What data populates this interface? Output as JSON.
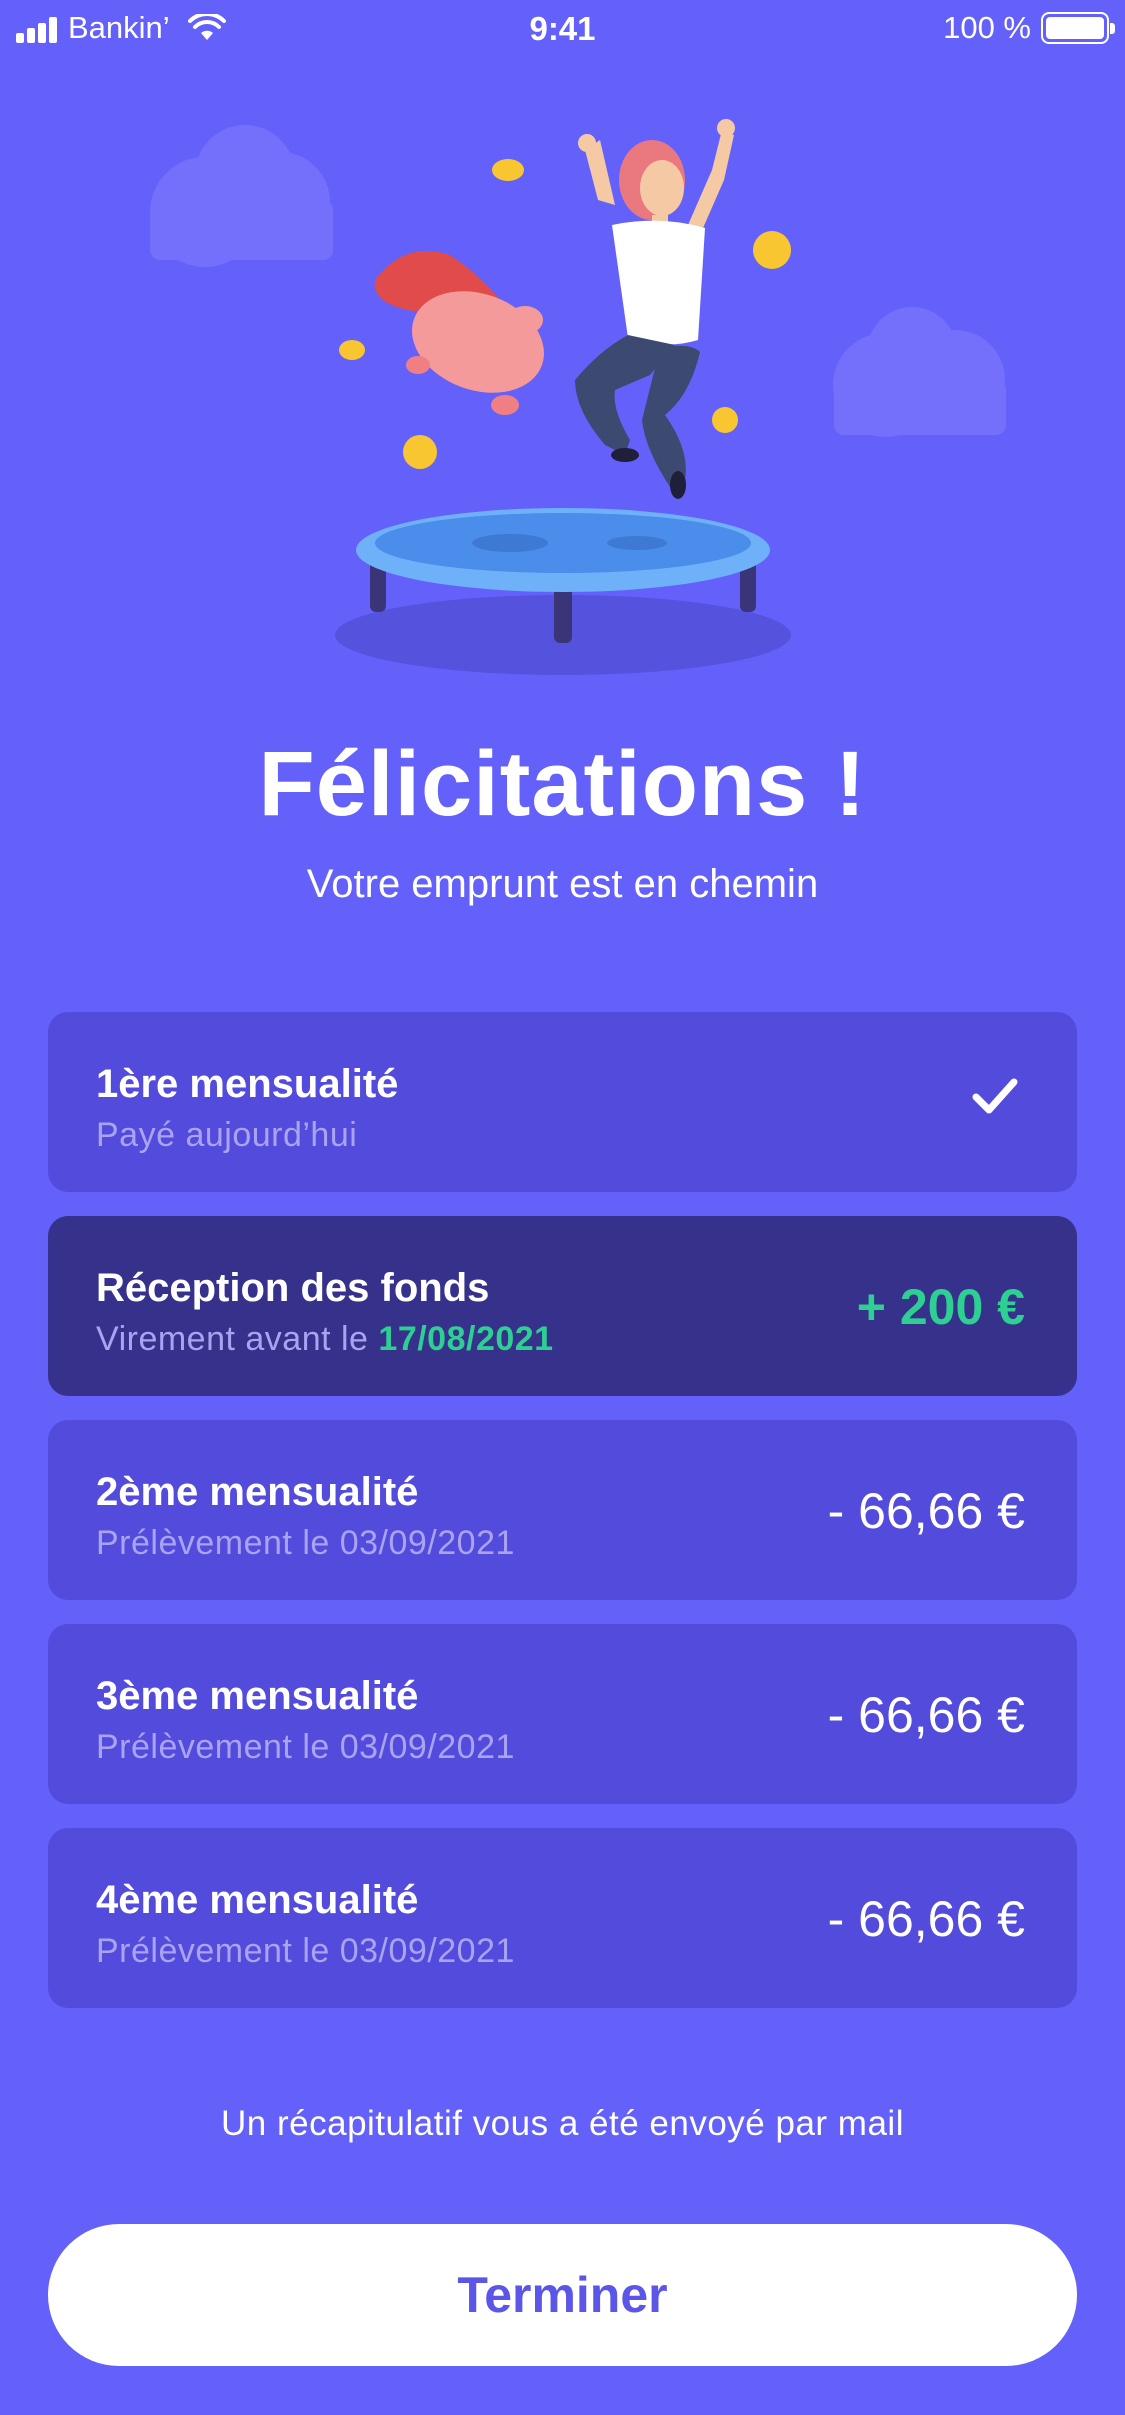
{
  "status_bar": {
    "carrier": "Bankin’",
    "time": "9:41",
    "battery": "100 %"
  },
  "illustration": {
    "icon": "celebration-trampoline-illustration"
  },
  "header": {
    "title": "Félicitations !",
    "subtitle": "Votre emprunt est en chemin"
  },
  "schedule": [
    {
      "title": "1ère mensualité",
      "subtitle": "Payé aujourd’hui",
      "status_icon": "check-icon"
    },
    {
      "title": "Réception des fonds",
      "subtitle_prefix": "Virement avant le ",
      "subtitle_date": "17/08/2021",
      "amount": "+ 200 €"
    },
    {
      "title": "2ème mensualité",
      "subtitle": "Prélèvement le 03/09/2021",
      "amount": "- 66,66 €"
    },
    {
      "title": "3ème mensualité",
      "subtitle": "Prélèvement le 03/09/2021",
      "amount": "- 66,66 €"
    },
    {
      "title": "4ème mensualité",
      "subtitle": "Prélèvement le 03/09/2021",
      "amount": "- 66,66 €"
    }
  ],
  "footer": {
    "note": "Un récapitulatif vous a été envoyé par mail",
    "finish_label": "Terminer"
  },
  "colors": {
    "background": "#6461FB",
    "card": "#534BDB",
    "card_highlight": "#36318A",
    "accent_green": "#2ECF93",
    "button_text": "#5C56E8"
  }
}
